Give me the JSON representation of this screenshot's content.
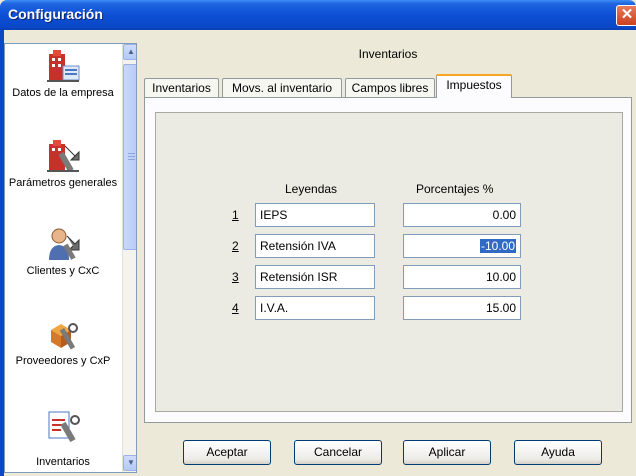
{
  "window": {
    "title": "Configuración"
  },
  "sidebar": {
    "items": [
      {
        "label": "Datos de la empresa",
        "icon": "building-icon"
      },
      {
        "label": "Parámetros generales",
        "icon": "building-wrench-icon"
      },
      {
        "label": "Clientes y CxC",
        "icon": "person-wrench-icon"
      },
      {
        "label": "Proveedores y CxP",
        "icon": "box-wrench-icon"
      },
      {
        "label": "Inventarios",
        "icon": "clipboard-wrench-icon"
      }
    ]
  },
  "content": {
    "header": "Inventarios",
    "tabs": [
      {
        "label": "Inventarios"
      },
      {
        "label": "Movs. al inventario"
      },
      {
        "label": "Campos libres"
      },
      {
        "label": "Impuestos",
        "active": true
      }
    ],
    "columns": {
      "leyendas": "Leyendas",
      "porcentajes": "Porcentajes %"
    },
    "rows": [
      {
        "num": "1",
        "leyenda": "IEPS",
        "porcentaje": "0.00"
      },
      {
        "num": "2",
        "leyenda": "Retensión IVA",
        "porcentaje": "-10.00"
      },
      {
        "num": "3",
        "leyenda": "Retensión ISR",
        "porcentaje": "10.00"
      },
      {
        "num": "4",
        "leyenda": "I.V.A.",
        "porcentaje": "15.00"
      }
    ]
  },
  "buttons": {
    "aceptar": "Aceptar",
    "cancelar": "Cancelar",
    "aplicar": "Aplicar",
    "ayuda": "Ayuda"
  },
  "colors": {
    "titlebar": "#0b48c8",
    "tab_highlight": "#f5a623",
    "selection": "#316ac5"
  }
}
